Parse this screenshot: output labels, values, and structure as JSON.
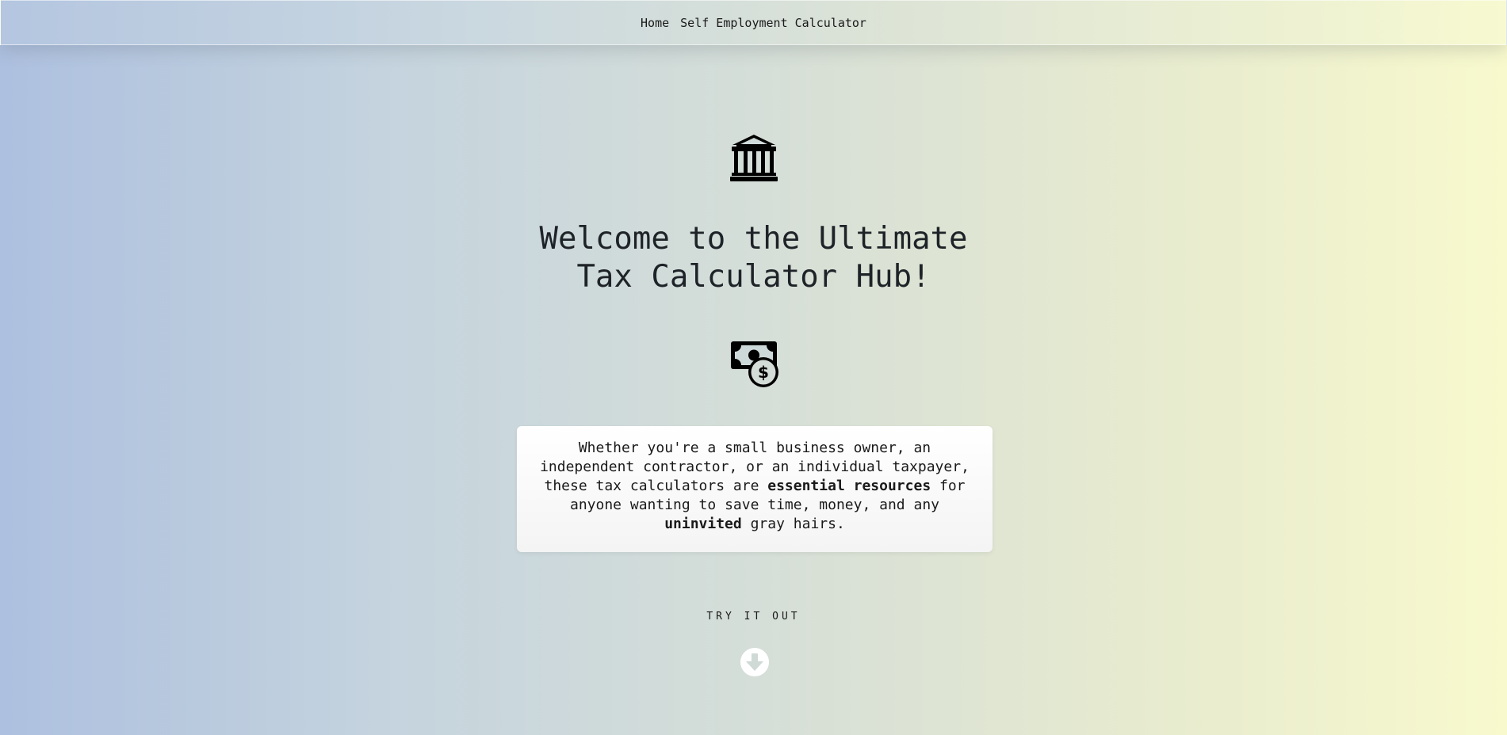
{
  "navbar": {
    "links": [
      {
        "label": "Home"
      },
      {
        "label": "Self Employment Calculator"
      }
    ]
  },
  "hero": {
    "title_line1": "Welcome to the Ultimate",
    "title_line2": "Tax Calculator Hub!",
    "top_icon": "bank-icon",
    "middle_icon": "money-bill-dollar-icon"
  },
  "description": {
    "part1": "Whether you're a small business owner, an independent contractor, or an individual taxpayer, these tax calculators are ",
    "bold1": "essential resources",
    "part2": " for anyone wanting to save time, money, and any ",
    "bold2": "uninvited",
    "part3": " gray hairs."
  },
  "cta": {
    "label": "TRY IT OUT",
    "icon": "arrow-down-circle-icon"
  },
  "colors": {
    "gradient_left": "#adc0df",
    "gradient_right": "#f8f9cd",
    "text": "#1a1a1a"
  }
}
